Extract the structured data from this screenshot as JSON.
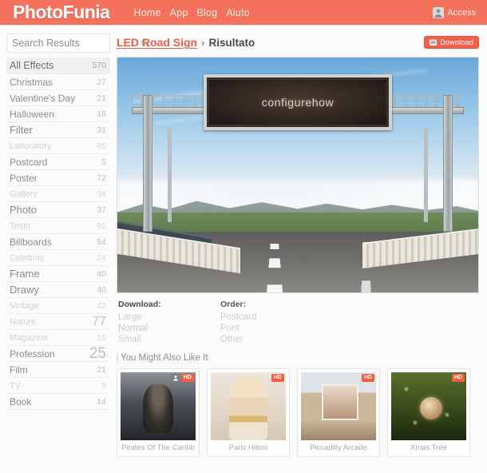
{
  "header": {
    "logo": "PhotoFunia",
    "nav": [
      {
        "label": "Home",
        "name": "nav-home"
      },
      {
        "label": "App",
        "name": "nav-app"
      },
      {
        "label": "Blog",
        "name": "nav-blog"
      },
      {
        "label": "Aiuto",
        "name": "nav-aiuto"
      }
    ],
    "account_label": "Access",
    "bar_color": "#f4715c"
  },
  "sidebar": {
    "search_value": "Search Results",
    "search_placeholder": "Search Results",
    "items": [
      {
        "label": "All Effects",
        "count": "570",
        "style": "active"
      },
      {
        "label": "Christmas",
        "count": "27",
        "style": "s12"
      },
      {
        "label": "Valentine's Day",
        "count": "21",
        "style": "s12"
      },
      {
        "label": "Halloween",
        "count": "18",
        "style": "s12"
      },
      {
        "label": "Filter",
        "count": "31",
        "style": "s13"
      },
      {
        "label": "Laboratory",
        "count": "95",
        "style": "faint"
      },
      {
        "label": "Postcard",
        "count": "5",
        "style": "s12"
      },
      {
        "label": "Poster",
        "count": "72",
        "style": "s12"
      },
      {
        "label": "Gallery",
        "count": "34",
        "style": "faint"
      },
      {
        "label": "Photo",
        "count": "37",
        "style": "s13"
      },
      {
        "label": "Testo",
        "count": "91",
        "style": "faint"
      },
      {
        "label": "Billboards",
        "count": "54",
        "style": "s12"
      },
      {
        "label": "Celebrity",
        "count": "24",
        "style": "faint"
      },
      {
        "label": "Frame",
        "count": "40",
        "style": "s13"
      },
      {
        "label": "Drawy",
        "count": "40",
        "style": "s13"
      },
      {
        "label": "Vintage",
        "count": "42",
        "style": "faint"
      },
      {
        "label": "Nature",
        "count": "77",
        "style": "big"
      },
      {
        "label": "Magazine",
        "count": "15",
        "style": "faint"
      },
      {
        "label": "Profession",
        "count": "25",
        "style": "xbig"
      },
      {
        "label": "Film",
        "count": "21",
        "style": "s12"
      },
      {
        "label": "TV",
        "count": "9",
        "style": "faint"
      },
      {
        "label": "Book",
        "count": "14",
        "style": "s12"
      }
    ]
  },
  "main": {
    "breadcrumb_link": "LED Road Sign",
    "breadcrumb_sep": "›",
    "breadcrumb_current": "Risultato",
    "download_button": "Download",
    "led_sign_text": "configurehow",
    "download": {
      "heading": "Download:",
      "options": [
        "Large",
        "Normal",
        "Small"
      ]
    },
    "order": {
      "heading": "Order:",
      "options": [
        "Postcard",
        "Print",
        "Other"
      ]
    },
    "suggestions_title": "You Might Also Like It",
    "suggestions": [
      {
        "caption": "Pirates Of The Caribb...",
        "hd": "HD",
        "has_user_badge": true,
        "art": "t1"
      },
      {
        "caption": "Paris Hilton",
        "hd": "HD",
        "has_user_badge": false,
        "art": "t2"
      },
      {
        "caption": "Piccadilly Arcade",
        "hd": "HD",
        "has_user_badge": false,
        "art": "t3"
      },
      {
        "caption": "Xmas Tree",
        "hd": "HD",
        "has_user_badge": false,
        "art": "t4"
      }
    ]
  }
}
